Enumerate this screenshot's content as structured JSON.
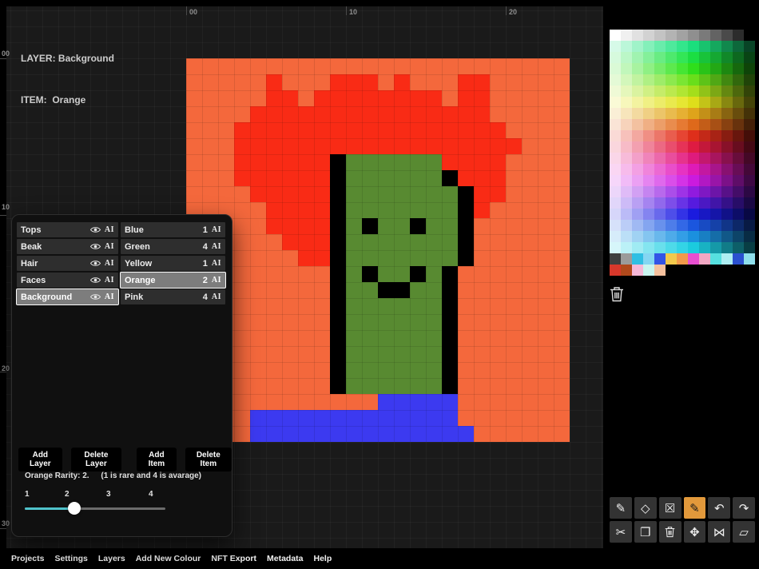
{
  "header": {
    "layer": "LAYER: Background",
    "item": "ITEM:  Orange"
  },
  "rulers": {
    "top": [
      "00",
      "10",
      "20"
    ],
    "left": [
      "00",
      "10",
      "20",
      "30"
    ]
  },
  "canvas": {
    "cols": 24,
    "rows": 24,
    "cell_size": 20,
    "colors": {
      ".": "#f4683c",
      "R": "#f92b15",
      "G": "#588a31",
      "K": "#000000",
      "B": "#3c3af0"
    },
    "grid": [
      "........................",
      ".....R...RRR.R...RR.....",
      ".....RR.RRRRRRRR.RR.....",
      "....RRRRRRRRRRRRRRR.....",
      "...RRRRRRRRRRRRRRRRR....",
      "...RRRRRRRRRRRRRRRRRR...",
      "...RRRRRRKGGGGGGRRRR....",
      "...RRRRRRKGGGGGGKRRR....",
      "....RRRRRKGGGGGGGKRR....",
      ".....RRRRKGGGGGGGKR.....",
      ".....RRRRKGKGGKGGK......",
      "......RRRKGGGGGGGK......",
      ".......RRKGGGGGGGK......",
      ".........KGKGGKGK.......",
      ".........KGGKKGGK.......",
      ".........KGGGGGGK.......",
      ".........KGGGGGGK.......",
      ".........KGGGGGGK.......",
      ".........KGGGGGGK.......",
      ".........KGGGGGGK.......",
      ".........KGGGGGGK.......",
      "............BBBBB.......",
      "....BBBBBBBBBBBBB.......",
      "....BBBBBBBBBBBBBB......"
    ]
  },
  "layers_panel": {
    "layers": [
      {
        "name": "Tops",
        "selected": false
      },
      {
        "name": "Beak",
        "selected": false
      },
      {
        "name": "Hair",
        "selected": false
      },
      {
        "name": "Faces",
        "selected": false
      },
      {
        "name": "Background",
        "selected": true
      }
    ],
    "items": [
      {
        "name": "Blue",
        "rarity": "1",
        "selected": false
      },
      {
        "name": "Green",
        "rarity": "4",
        "selected": false
      },
      {
        "name": "Yellow",
        "rarity": "1",
        "selected": false
      },
      {
        "name": "Orange",
        "rarity": "2",
        "selected": true
      },
      {
        "name": "Pink",
        "rarity": "4",
        "selected": false
      }
    ],
    "rename_glyph": "AI",
    "buttons": [
      "Add Layer",
      "Delete Layer",
      "Add Item",
      "Delete Item"
    ],
    "rarity_text": "Orange Rarity: 2.",
    "rarity_hint": "(1 is rare and 4 is avarage)",
    "slider": {
      "labels": [
        "1",
        "2",
        "3",
        "4"
      ],
      "value": 2,
      "position_pct": 35,
      "accent_color": "#4fc3cb",
      "track_color": "#6b6b6b"
    }
  },
  "palette": {
    "current_color": "#000000",
    "grayscale_row": [
      "#ffffff",
      "#f0f0f0",
      "#e1e1e1",
      "#d2d2d2",
      "#c3c3c3",
      "#b3b3b3",
      "#a2a2a2",
      "#8f8f8f",
      "#7a7a7a",
      "#636363",
      "#4a4a4a",
      "#2c2c2c",
      "#000000"
    ],
    "hue_rows": [
      150,
      132,
      114,
      96,
      78,
      60,
      42,
      24,
      6,
      348,
      330,
      312,
      294,
      276,
      258,
      240,
      222,
      204,
      186
    ],
    "saturation": 78,
    "lightness_steps": [
      91,
      85,
      79,
      73,
      67,
      61,
      55,
      49,
      43,
      37,
      30,
      23,
      15
    ],
    "extra_rows": [
      [
        "#3f3f3f",
        "#9b9b9b",
        "#2fbfe3",
        "#84d6f2",
        "#3354e6",
        "#f2c94c",
        "#f2994a",
        "#e84fd0",
        "#f2a7c3",
        "#56e0e0",
        "#aeeef2",
        "#2b50cf",
        "#8fdfeb"
      ],
      [
        "#d8382b",
        "#b0491c",
        "#f6b8d8",
        "#c9f5ef",
        "#f5c19e",
        "#000000"
      ]
    ]
  },
  "tools": {
    "active_color": "#e2993b",
    "rows": [
      [
        {
          "name": "pencil-tool",
          "glyph": "✎",
          "active": false
        },
        {
          "name": "shape-tool",
          "glyph": "◇",
          "active": false
        },
        {
          "name": "clear-selection-tool",
          "glyph": "☒",
          "active": false
        },
        {
          "name": "marker-tool",
          "glyph": "✎",
          "active": true
        },
        {
          "name": "undo-button",
          "glyph": "↶",
          "active": false
        },
        {
          "name": "redo-button",
          "glyph": "↷",
          "active": false
        }
      ],
      [
        {
          "name": "cut-tool",
          "glyph": "✂",
          "active": false
        },
        {
          "name": "copy-tool",
          "glyph": "❐",
          "active": false
        },
        {
          "name": "delete-tool",
          "glyph": "trash",
          "active": false
        },
        {
          "name": "move-tool",
          "glyph": "✥",
          "active": false
        },
        {
          "name": "flip-horizontal-tool",
          "glyph": "⋈",
          "active": false
        },
        {
          "name": "shear-tool",
          "glyph": "▱",
          "active": false
        }
      ]
    ]
  },
  "menu": {
    "items": [
      "Projects",
      "Settings",
      "Layers",
      "Add New Colour",
      "NFT Export",
      "Metadata",
      "Help"
    ]
  }
}
